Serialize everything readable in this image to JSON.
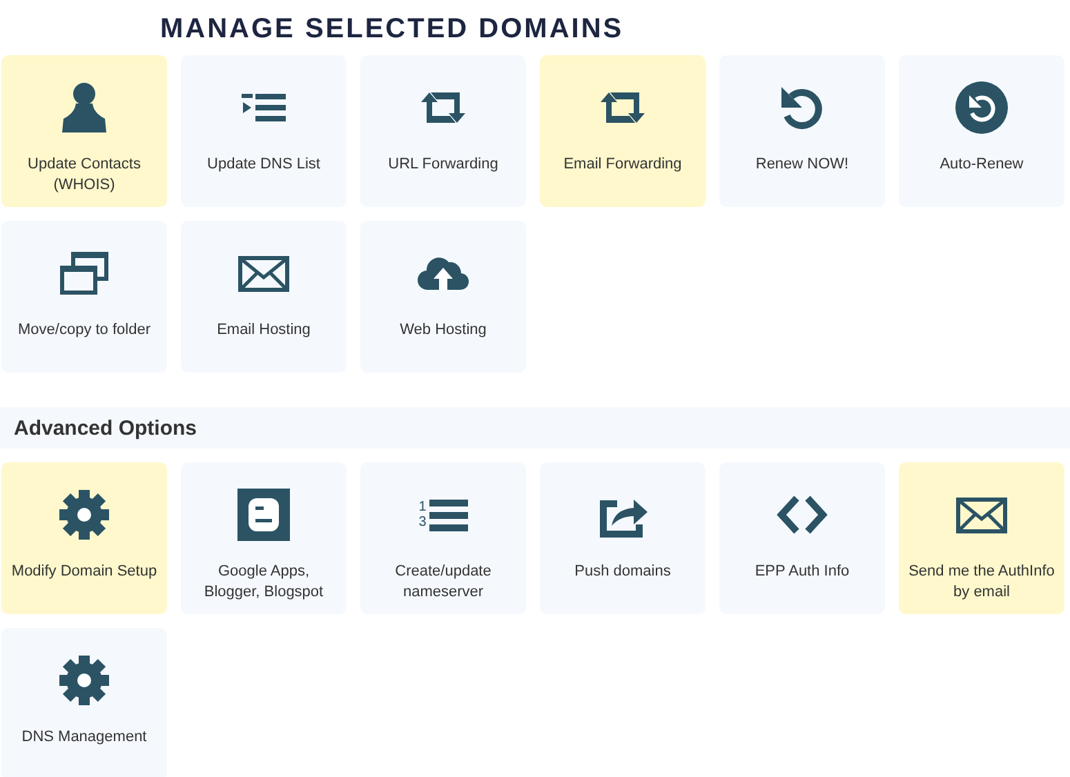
{
  "title": "MANAGE SELECTED DOMAINS",
  "tiles": [
    {
      "kind": "person",
      "label": "Update Contacts (WHOIS)",
      "highlighted": true
    },
    {
      "kind": "list",
      "label": "Update DNS List",
      "highlighted": false
    },
    {
      "kind": "retweet",
      "label": "URL Forwarding",
      "highlighted": false
    },
    {
      "kind": "retweet",
      "label": "Email Forwarding",
      "highlighted": true
    },
    {
      "kind": "undo",
      "label": "Renew NOW!",
      "highlighted": false
    },
    {
      "kind": "circle-undo",
      "label": "Auto-Renew",
      "highlighted": false
    },
    {
      "kind": "windows",
      "label": "Move/copy to folder",
      "highlighted": false
    },
    {
      "kind": "envelope",
      "label": "Email Hosting",
      "highlighted": false
    },
    {
      "kind": "cloud",
      "label": "Web Hosting",
      "highlighted": false
    }
  ],
  "advanced": {
    "heading": "Advanced Options",
    "tiles": [
      {
        "kind": "gear",
        "label": "Modify Domain Setup",
        "highlighted": true
      },
      {
        "kind": "blogger",
        "label": "Google Apps, Blogger, Blogspot",
        "highlighted": false
      },
      {
        "kind": "numbered-list",
        "label": "Create/update nameserver",
        "highlighted": false,
        "numbers": [
          "1",
          "3"
        ]
      },
      {
        "kind": "share",
        "label": "Push domains",
        "highlighted": false
      },
      {
        "kind": "code",
        "label": "EPP Auth Info",
        "highlighted": false
      },
      {
        "kind": "envelope",
        "label": "Send me the AuthInfo by email",
        "highlighted": true
      },
      {
        "kind": "gear",
        "label": "DNS Management",
        "highlighted": false
      }
    ]
  }
}
